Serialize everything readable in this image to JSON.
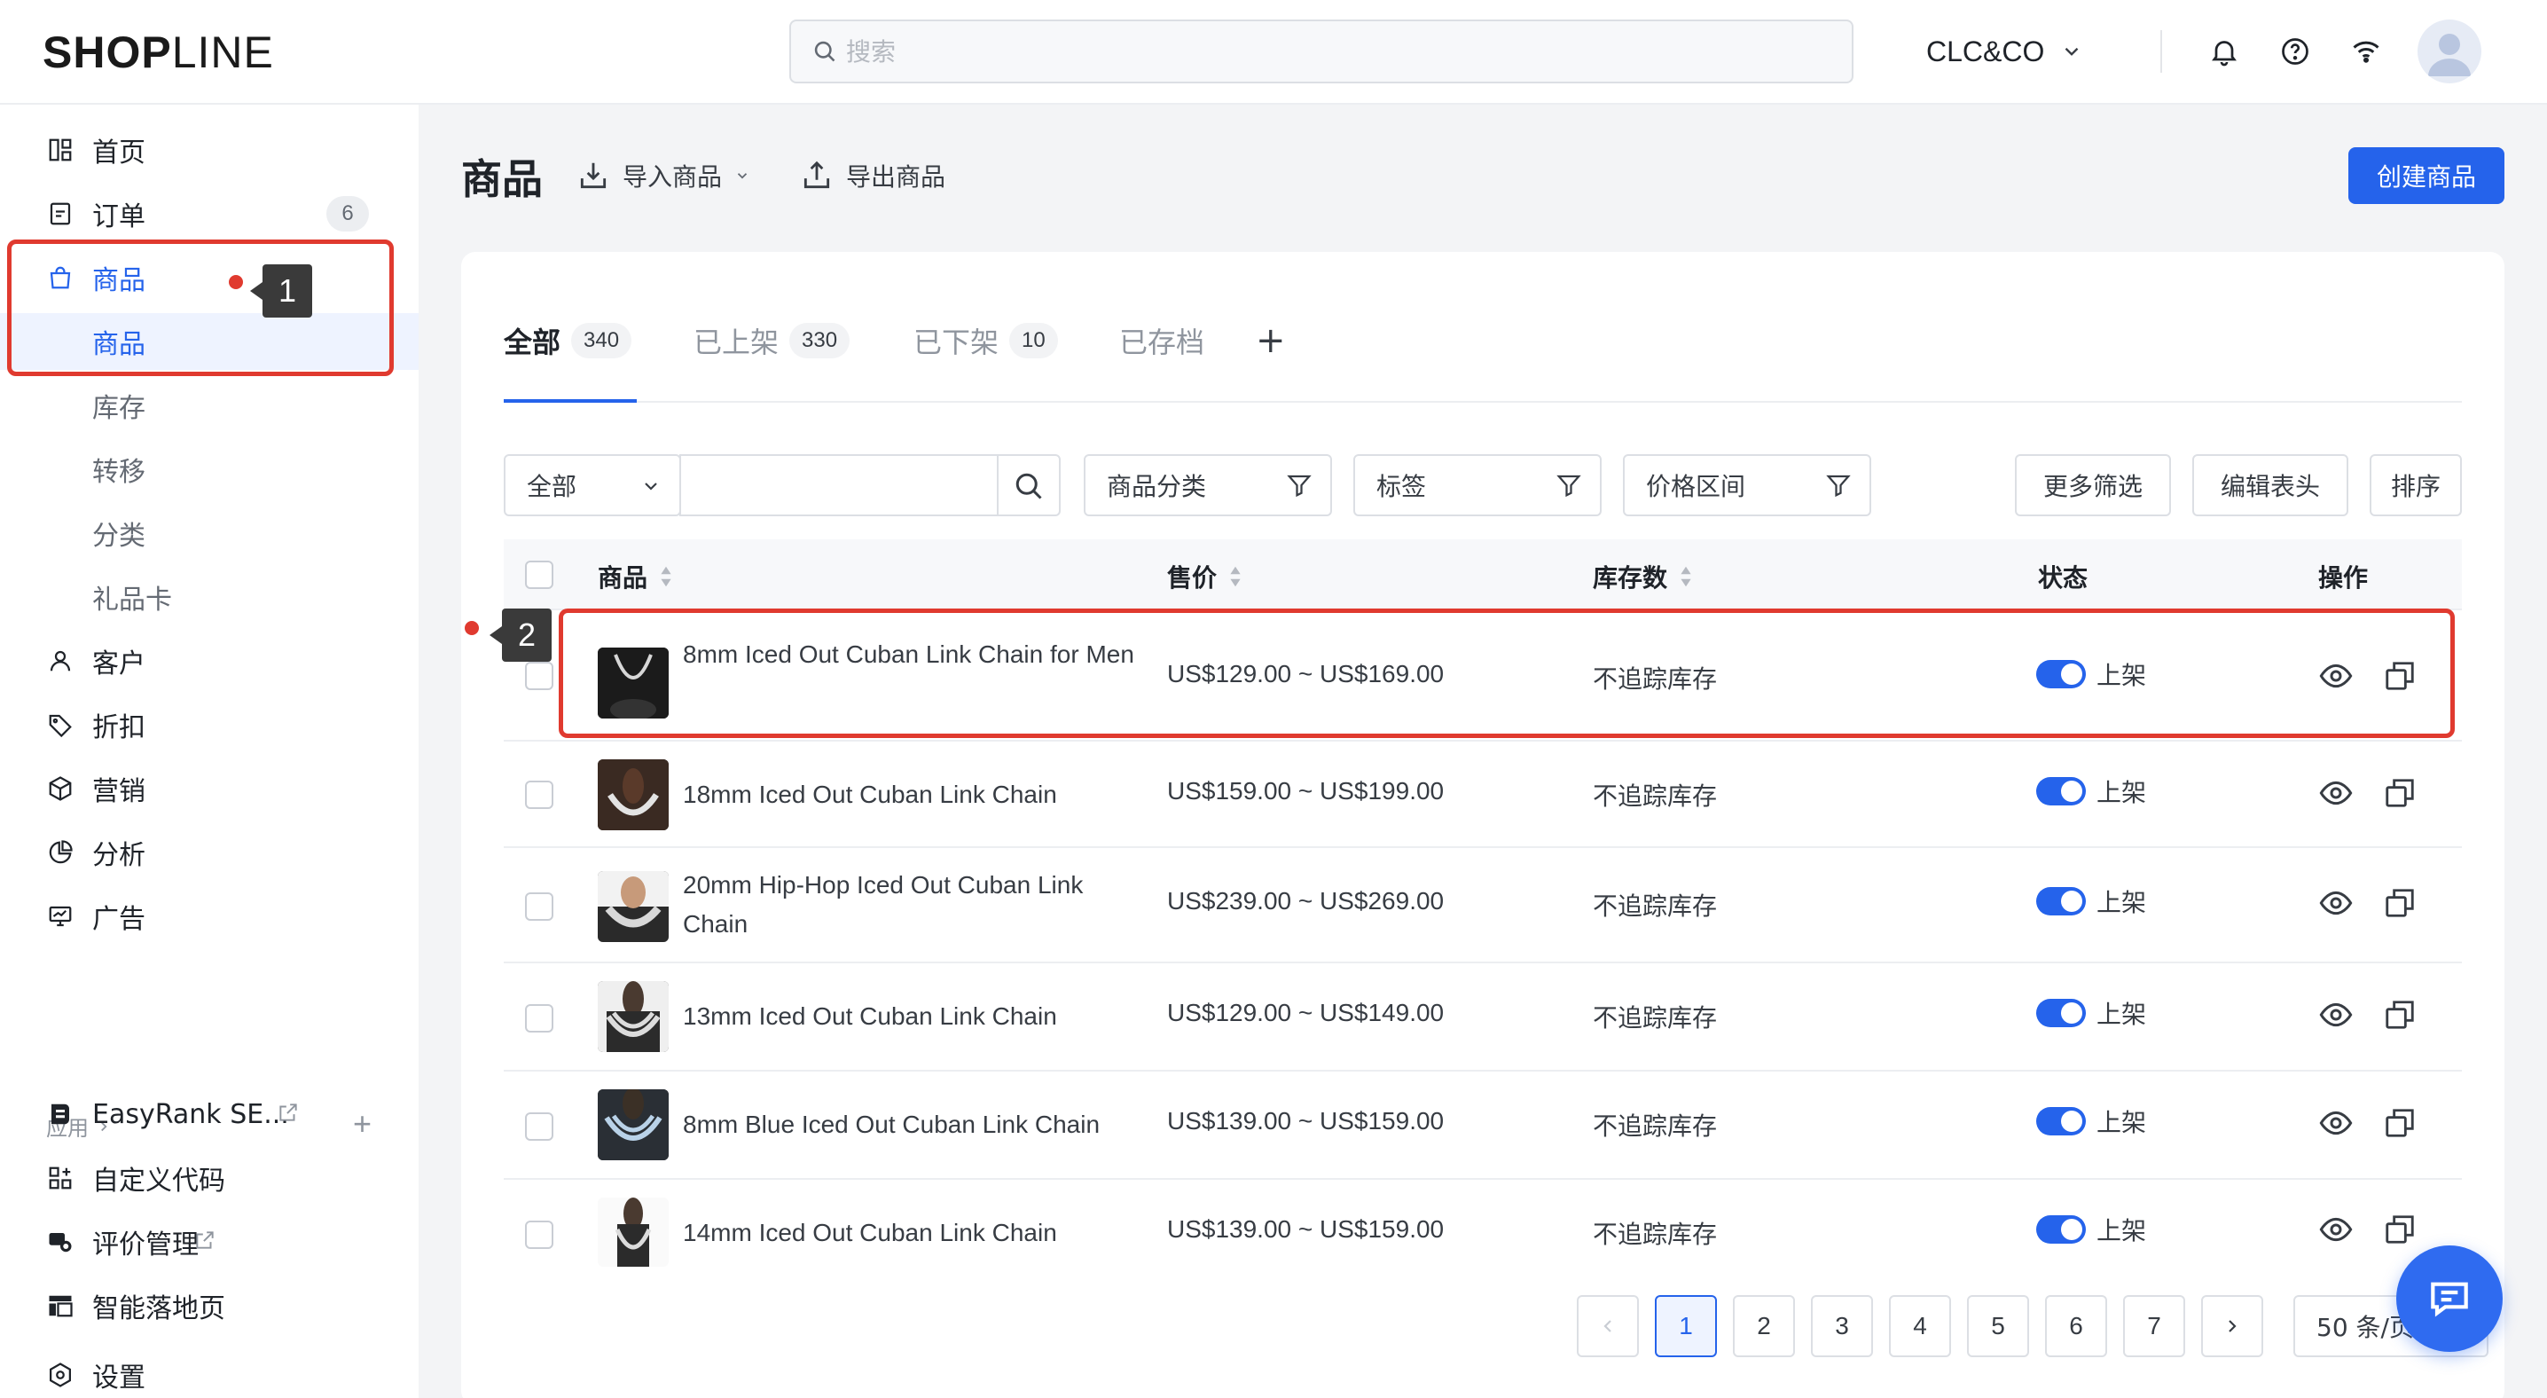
{
  "topbar": {
    "logo_bold": "SHOP",
    "logo_light": "LINE",
    "search_placeholder": "搜索",
    "store_name": "CLC&CO"
  },
  "sidebar": {
    "items": [
      {
        "label": "首页",
        "icon": "dashboard-icon"
      },
      {
        "label": "订单",
        "icon": "order-icon",
        "badge": "6"
      },
      {
        "label": "商品",
        "icon": "bag-icon"
      },
      {
        "label": "商品"
      },
      {
        "label": "库存"
      },
      {
        "label": "转移"
      },
      {
        "label": "分类"
      },
      {
        "label": "礼品卡"
      },
      {
        "label": "客户",
        "icon": "user-icon"
      },
      {
        "label": "折扣",
        "icon": "tag-icon"
      },
      {
        "label": "营销",
        "icon": "cube-icon"
      },
      {
        "label": "分析",
        "icon": "pie-chart-icon"
      },
      {
        "label": "广告",
        "icon": "monitor-icon"
      }
    ],
    "apps_header": "应用",
    "apps": [
      {
        "label": "EasyRank SE...",
        "icon": "easyrank-icon"
      },
      {
        "label": "自定义代码",
        "icon": "grid-code-icon"
      },
      {
        "label": "评价管理",
        "icon": "review-icon"
      },
      {
        "label": "智能落地页",
        "icon": "landing-page-icon"
      }
    ],
    "settings_label": "设置"
  },
  "annotations": {
    "marker_1": "1",
    "marker_2": "2"
  },
  "header": {
    "title": "商品",
    "import_label": "导入商品",
    "export_label": "导出商品",
    "create_label": "创建商品"
  },
  "tabs": [
    {
      "label": "全部",
      "count": "340"
    },
    {
      "label": "已上架",
      "count": "330"
    },
    {
      "label": "已下架",
      "count": "10"
    },
    {
      "label": "已存档"
    }
  ],
  "filters": {
    "scope": "全部",
    "category": "商品分类",
    "tags": "标签",
    "price_range": "价格区间",
    "more_filters": "更多筛选",
    "edit_columns": "编辑表头",
    "sort": "排序"
  },
  "table": {
    "columns": {
      "product": "商品",
      "price": "售价",
      "stock": "库存数",
      "status": "状态",
      "actions": "操作"
    },
    "rows": [
      {
        "name": "8mm Iced Out Cuban Link Chain for Men",
        "price": "US$129.00 ~ US$169.00",
        "stock": "不追踪库存",
        "status": "上架"
      },
      {
        "name": "18mm Iced Out Cuban Link Chain",
        "price": "US$159.00 ~ US$199.00",
        "stock": "不追踪库存",
        "status": "上架"
      },
      {
        "name": "20mm Hip-Hop Iced Out Cuban Link Chain",
        "price": "US$239.00 ~ US$269.00",
        "stock": "不追踪库存",
        "status": "上架"
      },
      {
        "name": "13mm Iced Out Cuban Link Chain",
        "price": "US$129.00 ~ US$149.00",
        "stock": "不追踪库存",
        "status": "上架"
      },
      {
        "name": "8mm Blue Iced Out Cuban Link Chain",
        "price": "US$139.00 ~ US$159.00",
        "stock": "不追踪库存",
        "status": "上架"
      },
      {
        "name": "14mm Iced Out Cuban Link Chain",
        "price": "US$139.00 ~ US$159.00",
        "stock": "不追踪库存",
        "status": "上架"
      }
    ]
  },
  "pagination": {
    "pages": [
      "1",
      "2",
      "3",
      "4",
      "5",
      "6",
      "7"
    ],
    "current": "1",
    "page_size": "50 条/页"
  },
  "colors": {
    "accent": "#2563eb",
    "annotation_red": "#e03a2f"
  }
}
